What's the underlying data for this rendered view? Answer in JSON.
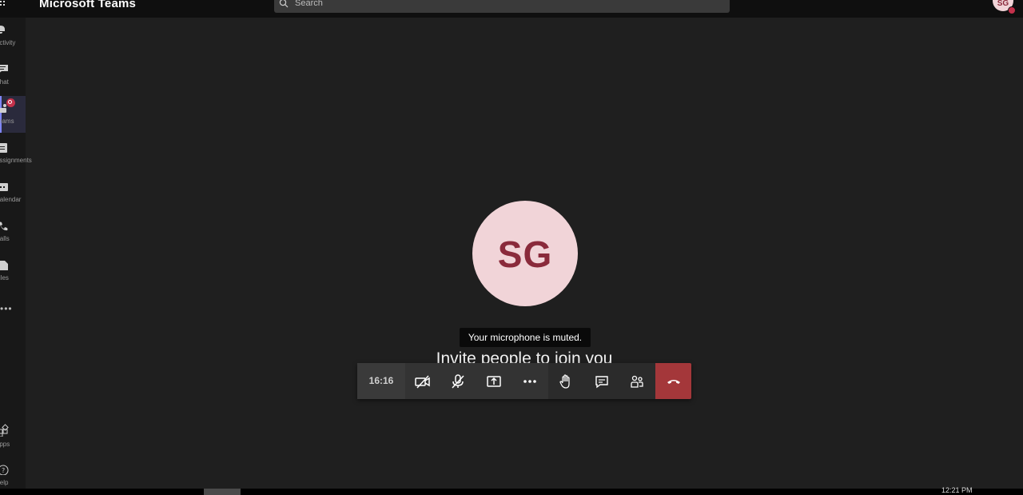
{
  "app": {
    "title": "Microsoft Teams"
  },
  "search": {
    "placeholder": "Search",
    "icon": "search-icon"
  },
  "profile": {
    "initials": "SG",
    "status_color": "#c4314b"
  },
  "rail": {
    "items": [
      {
        "label": "Activity",
        "icon": "bell-icon"
      },
      {
        "label": "Chat",
        "icon": "chat-icon"
      },
      {
        "label": "Teams",
        "icon": "teams-icon",
        "active": true,
        "badge": true
      },
      {
        "label": "Assignments",
        "icon": "assignments-icon"
      },
      {
        "label": "Calendar",
        "icon": "calendar-icon"
      },
      {
        "label": "Calls",
        "icon": "phone-icon"
      },
      {
        "label": "Files",
        "icon": "file-icon"
      }
    ],
    "more": "•••",
    "apps_label": "Apps",
    "help_label": "Help"
  },
  "call": {
    "participant_initials": "SG",
    "tooltip": "Your microphone is muted.",
    "invite_text": "Invite people to join you",
    "timer": "16:16",
    "controls": [
      {
        "name": "camera-off-button",
        "icon": "camera-off-icon"
      },
      {
        "name": "mic-off-button",
        "icon": "mic-off-icon"
      },
      {
        "name": "share-screen-button",
        "icon": "share-screen-icon"
      },
      {
        "name": "more-actions-button",
        "icon": "more-icon"
      },
      {
        "name": "raise-hand-button",
        "icon": "hand-icon"
      },
      {
        "name": "show-conversation-button",
        "icon": "chat-icon"
      },
      {
        "name": "show-participants-button",
        "icon": "participants-icon"
      },
      {
        "name": "hang-up-button",
        "icon": "hang-up-icon"
      }
    ]
  },
  "taskbar": {
    "clock": "12:21 PM"
  },
  "colors": {
    "accent": "#7f85f5",
    "hangup": "#a4373a",
    "avatar_bg": "#f1d4d8",
    "avatar_text": "#8a2a3b"
  }
}
